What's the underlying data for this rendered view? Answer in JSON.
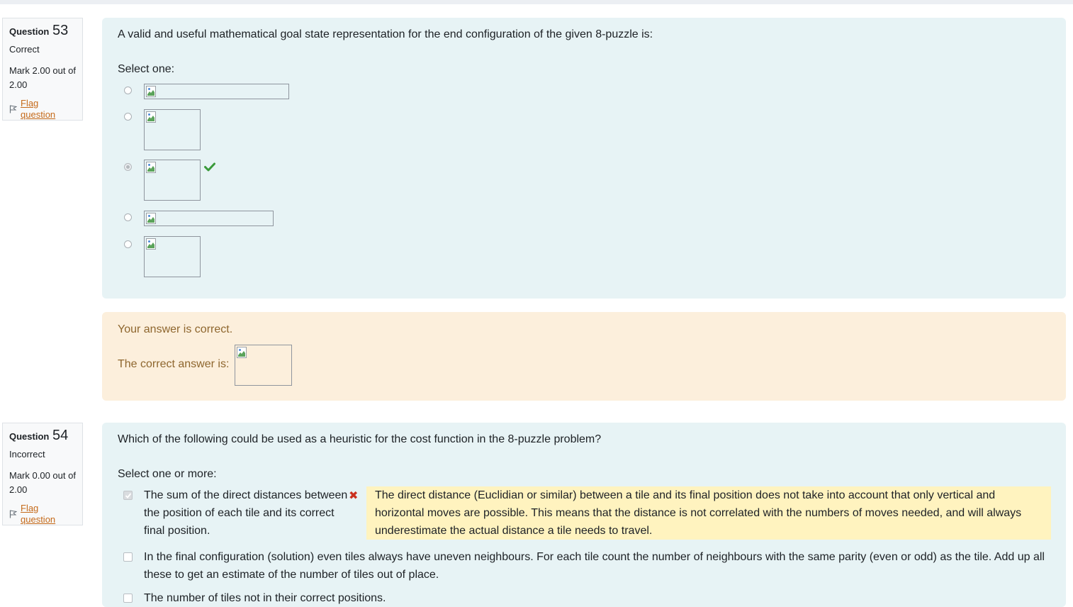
{
  "questions": [
    {
      "label": "Question",
      "number": "53",
      "state": "Correct",
      "grade": "Mark 2.00 out of 2.00",
      "flag_label": "Flag question",
      "text": "A valid and useful mathematical goal state representation for the end configuration of the given 8-puzzle is:",
      "prompt": "Select one:",
      "options": [
        {
          "checked": false,
          "icon": "broken-image-icon",
          "mark": ""
        },
        {
          "checked": false,
          "icon": "broken-image-icon",
          "mark": ""
        },
        {
          "checked": true,
          "icon": "broken-image-icon",
          "mark": "check-icon"
        },
        {
          "checked": false,
          "icon": "broken-image-icon",
          "mark": ""
        },
        {
          "checked": false,
          "icon": "broken-image-icon",
          "mark": ""
        }
      ],
      "feedback": {
        "general": "Your answer is correct.",
        "right_answer_label": "The correct answer is:"
      }
    },
    {
      "label": "Question",
      "number": "54",
      "state": "Incorrect",
      "grade": "Mark 0.00 out of 2.00",
      "flag_label": "Flag question",
      "text": "Which of the following could be used as a heuristic for the cost function in the 8-puzzle problem?",
      "prompt": "Select one or more:",
      "options": [
        {
          "checked": true,
          "text": "The sum of the direct distances between the position of each tile and its correct final position.",
          "mark": "cross-icon",
          "specific_feedback": "The direct distance (Euclidian or similar) between a tile and its final position does not take into account that only vertical and horizontal moves are possible. This means that the distance is not correlated with the numbers of moves needed, and will always underestimate the actual distance a tile needs to travel."
        },
        {
          "checked": false,
          "text": "In the final configuration (solution) even tiles always have uneven neighbours. For each tile count the number of neighbours with the same parity (even or odd) as the tile. Add up all these to get an estimate of the number of tiles out of place."
        },
        {
          "checked": false,
          "text": "The number of tiles not in their correct positions."
        }
      ]
    }
  ],
  "colors": {
    "formulation_bg": "#e7f3f5",
    "feedback_bg": "#fcefdc",
    "feedback_text": "#8e662e",
    "specific_feedback_bg": "#fff3bf",
    "correct": "#3a9a3a",
    "incorrect": "#ca3120",
    "flag_link": "#c56a1a"
  }
}
